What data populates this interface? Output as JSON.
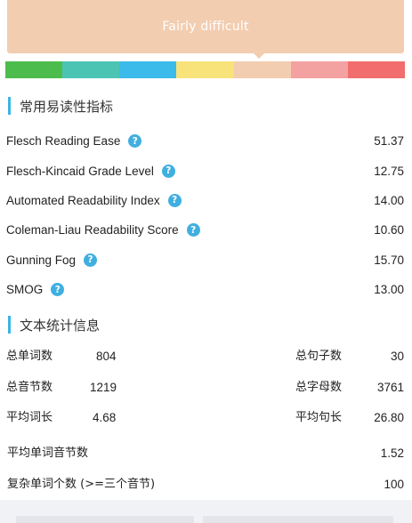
{
  "banner": {
    "text": "Fairly difficult"
  },
  "scale": {
    "colors": [
      "#4cbd4c",
      "#4cc4b3",
      "#3bbbea",
      "#f8e37a",
      "#f3cdb0",
      "#f4a1a1",
      "#f26d6d"
    ],
    "active_index": 4
  },
  "readability": {
    "title": "常用易读性指标",
    "metrics": [
      {
        "name": "Flesch Reading Ease",
        "value": "51.37"
      },
      {
        "name": "Flesch-Kincaid Grade Level",
        "value": "12.75"
      },
      {
        "name": "Automated Readability Index",
        "value": "14.00"
      },
      {
        "name": "Coleman-Liau Readability Score",
        "value": "10.60"
      },
      {
        "name": "Gunning Fog",
        "value": "15.70"
      },
      {
        "name": "SMOG",
        "value": "13.00"
      }
    ],
    "help_glyph": "?"
  },
  "stats": {
    "title": "文本统计信息",
    "word_count_label": "总单词数",
    "word_count": "804",
    "sentence_count_label": "总句子数",
    "sentence_count": "30",
    "syllable_count_label": "总音节数",
    "syllable_count": "1219",
    "letter_count_label": "总字母数",
    "letter_count": "3761",
    "avg_word_length_label": "平均词长",
    "avg_word_length": "4.68",
    "avg_sentence_length_label": "平均句长",
    "avg_sentence_length": "26.80",
    "avg_syllables_label": "平均单词音节数",
    "avg_syllables": "1.52",
    "complex_words_label": "复杂单词个数 (>=三个音节)",
    "complex_words": "100"
  }
}
